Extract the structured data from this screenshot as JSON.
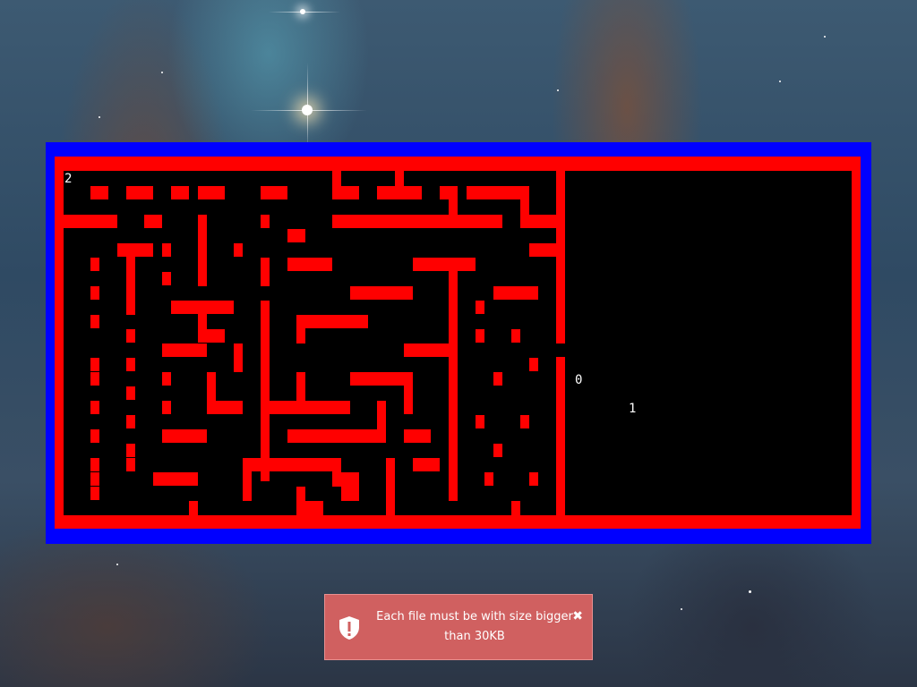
{
  "game": {
    "labels": {
      "score_top_left": "2",
      "marker_0": "0",
      "marker_1": "1"
    },
    "colors": {
      "frame": "#0000ff",
      "wall": "#ff0000",
      "floor": "#000000",
      "label": "#ffffff"
    }
  },
  "toast": {
    "message": "Each file must be with size bigger than 30KB",
    "icon": "shield-exclamation-icon",
    "close_icon": "close-icon",
    "color": "#d06060"
  }
}
